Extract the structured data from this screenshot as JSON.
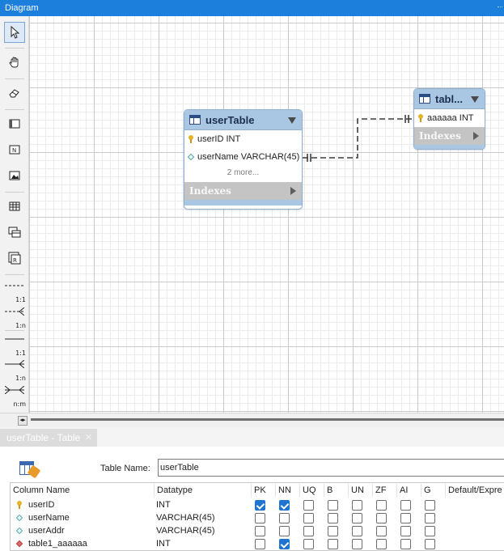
{
  "window": {
    "title": "Diagram"
  },
  "toolbar": {
    "tools": [
      {
        "name": "pointer-tool",
        "icon": "arrow-pointer"
      },
      {
        "name": "hand-tool",
        "icon": "hand"
      },
      {
        "name": "eraser-tool",
        "icon": "eraser"
      },
      {
        "name": "layer-tool",
        "icon": "layer"
      },
      {
        "name": "note-tool",
        "icon": "note"
      },
      {
        "name": "image-tool",
        "icon": "image"
      },
      {
        "name": "table-tool",
        "icon": "table"
      },
      {
        "name": "view-tool",
        "icon": "view"
      },
      {
        "name": "routine-group-tool",
        "icon": "routine-group"
      }
    ],
    "relationships": [
      {
        "label": "1:1",
        "style": "non-identifying"
      },
      {
        "label": "1:n",
        "style": "non-identifying"
      },
      {
        "label": "1:1",
        "style": "identifying"
      },
      {
        "label": "1:n",
        "style": "identifying"
      },
      {
        "label": "n:m",
        "style": "identifying"
      }
    ]
  },
  "diagram": {
    "entities": [
      {
        "name": "userTable",
        "columns": [
          {
            "icon": "key",
            "text": "userID INT"
          },
          {
            "icon": "diamond",
            "text": "userName VARCHAR(45)"
          }
        ],
        "more": "2 more...",
        "indexes": "Indexes"
      },
      {
        "name": "tabl...",
        "columns": [
          {
            "icon": "key",
            "text": "aaaaaa INT"
          }
        ],
        "indexes": "Indexes"
      }
    ]
  },
  "editor_tab": {
    "label": "userTable - Table",
    "close": "✕"
  },
  "editor": {
    "table_name_label": "Table Name:",
    "table_name_value": "userTable",
    "headers": [
      "Column Name",
      "Datatype",
      "PK",
      "NN",
      "UQ",
      "B",
      "UN",
      "ZF",
      "AI",
      "G",
      "Default/Expre"
    ],
    "rows": [
      {
        "icon": "key",
        "name": "userID",
        "type": "INT",
        "flags": [
          true,
          true,
          false,
          false,
          false,
          false,
          false,
          false
        ]
      },
      {
        "icon": "diamond",
        "name": "userName",
        "type": "VARCHAR(45)",
        "flags": [
          false,
          false,
          false,
          false,
          false,
          false,
          false,
          false
        ]
      },
      {
        "icon": "diamond",
        "name": "userAddr",
        "type": "VARCHAR(45)",
        "flags": [
          false,
          false,
          false,
          false,
          false,
          false,
          false,
          false
        ]
      },
      {
        "icon": "diamond-red",
        "name": "table1_aaaaaa",
        "type": "INT",
        "flags": [
          false,
          true,
          false,
          false,
          false,
          false,
          false,
          false
        ]
      }
    ]
  },
  "colors": {
    "titlebar": "#1c7fdc",
    "entity_header": "#a9c6e3",
    "checkbox_on": "#1f74d1"
  }
}
